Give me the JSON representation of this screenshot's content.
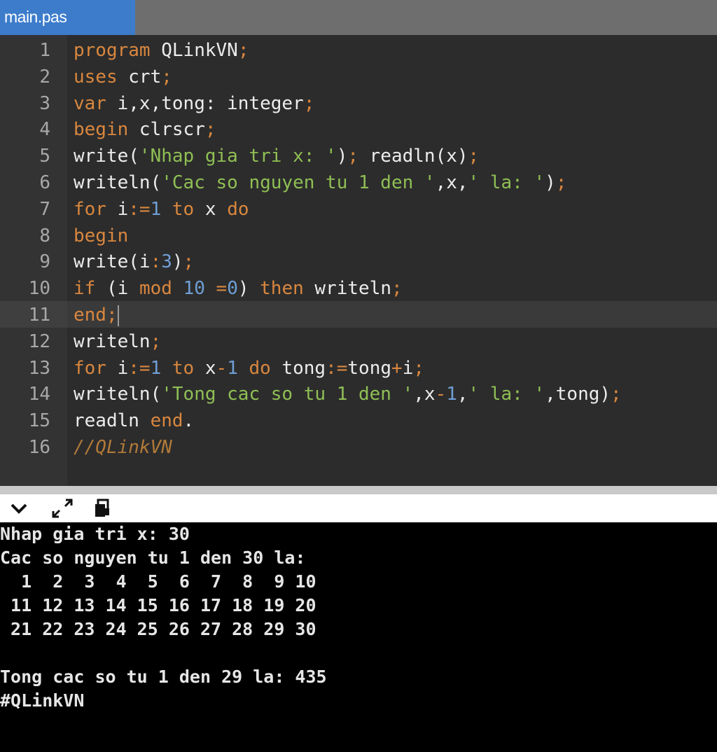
{
  "tab": {
    "title": "main.pas"
  },
  "editor": {
    "line_numbers": [
      "1",
      "2",
      "3",
      "4",
      "5",
      "6",
      "7",
      "8",
      "9",
      "10",
      "11",
      "12",
      "13",
      "14",
      "15",
      "16"
    ],
    "lines": [
      [
        {
          "t": "program",
          "c": "kw"
        },
        {
          "t": " QLinkVN",
          "c": ""
        },
        {
          "t": ";",
          "c": "op"
        }
      ],
      [
        {
          "t": "uses",
          "c": "kw"
        },
        {
          "t": " crt",
          "c": ""
        },
        {
          "t": ";",
          "c": "op"
        }
      ],
      [
        {
          "t": "var",
          "c": "kw"
        },
        {
          "t": " i,x,tong: integer",
          "c": ""
        },
        {
          "t": ";",
          "c": "op"
        }
      ],
      [
        {
          "t": "begin",
          "c": "kw"
        },
        {
          "t": " clrscr",
          "c": ""
        },
        {
          "t": ";",
          "c": "op"
        }
      ],
      [
        {
          "t": "write(",
          "c": ""
        },
        {
          "t": "'Nhap gia tri x: '",
          "c": "str"
        },
        {
          "t": ")",
          "c": ""
        },
        {
          "t": ";",
          "c": "op"
        },
        {
          "t": " readln(x)",
          "c": ""
        },
        {
          "t": ";",
          "c": "op"
        }
      ],
      [
        {
          "t": "writeln(",
          "c": ""
        },
        {
          "t": "'Cac so nguyen tu 1 den '",
          "c": "str"
        },
        {
          "t": ",x,",
          "c": ""
        },
        {
          "t": "' la: '",
          "c": "str"
        },
        {
          "t": ")",
          "c": ""
        },
        {
          "t": ";",
          "c": "op"
        }
      ],
      [
        {
          "t": "for",
          "c": "kw"
        },
        {
          "t": " i",
          "c": ""
        },
        {
          "t": ":=",
          "c": "op"
        },
        {
          "t": "1",
          "c": "num"
        },
        {
          "t": " ",
          "c": ""
        },
        {
          "t": "to",
          "c": "kw"
        },
        {
          "t": " x ",
          "c": ""
        },
        {
          "t": "do",
          "c": "kw"
        }
      ],
      [
        {
          "t": "begin",
          "c": "kw"
        }
      ],
      [
        {
          "t": "write(i",
          "c": ""
        },
        {
          "t": ":",
          "c": "op"
        },
        {
          "t": "3",
          "c": "num"
        },
        {
          "t": ")",
          "c": ""
        },
        {
          "t": ";",
          "c": "op"
        }
      ],
      [
        {
          "t": "if",
          "c": "kw"
        },
        {
          "t": " (i ",
          "c": ""
        },
        {
          "t": "mod",
          "c": "kw"
        },
        {
          "t": " ",
          "c": ""
        },
        {
          "t": "10",
          "c": "num"
        },
        {
          "t": " ",
          "c": ""
        },
        {
          "t": "=",
          "c": "op"
        },
        {
          "t": "0",
          "c": "num"
        },
        {
          "t": ") ",
          "c": ""
        },
        {
          "t": "then",
          "c": "kw"
        },
        {
          "t": " writeln",
          "c": ""
        },
        {
          "t": ";",
          "c": "op"
        }
      ],
      [
        {
          "t": "end",
          "c": "kw"
        },
        {
          "t": ";",
          "c": "op"
        }
      ],
      [
        {
          "t": "writeln",
          "c": ""
        },
        {
          "t": ";",
          "c": "op"
        }
      ],
      [
        {
          "t": "for",
          "c": "kw"
        },
        {
          "t": " i",
          "c": ""
        },
        {
          "t": ":=",
          "c": "op"
        },
        {
          "t": "1",
          "c": "num"
        },
        {
          "t": " ",
          "c": ""
        },
        {
          "t": "to",
          "c": "kw"
        },
        {
          "t": " x",
          "c": ""
        },
        {
          "t": "-",
          "c": "op"
        },
        {
          "t": "1",
          "c": "num"
        },
        {
          "t": " ",
          "c": ""
        },
        {
          "t": "do",
          "c": "kw"
        },
        {
          "t": " tong",
          "c": ""
        },
        {
          "t": ":=",
          "c": "op"
        },
        {
          "t": "tong",
          "c": ""
        },
        {
          "t": "+",
          "c": "op"
        },
        {
          "t": "i",
          "c": ""
        },
        {
          "t": ";",
          "c": "op"
        }
      ],
      [
        {
          "t": "writeln(",
          "c": ""
        },
        {
          "t": "'Tong cac so tu 1 den '",
          "c": "str"
        },
        {
          "t": ",x",
          "c": ""
        },
        {
          "t": "-",
          "c": "op"
        },
        {
          "t": "1",
          "c": "num"
        },
        {
          "t": ",",
          "c": ""
        },
        {
          "t": "' la: '",
          "c": "str"
        },
        {
          "t": ",tong)",
          "c": ""
        },
        {
          "t": ";",
          "c": "op"
        }
      ],
      [
        {
          "t": "readln ",
          "c": ""
        },
        {
          "t": "end",
          "c": "kw"
        },
        {
          "t": ".",
          "c": ""
        }
      ],
      [
        {
          "t": "//QLinkVN",
          "c": "cmt"
        }
      ]
    ]
  },
  "toolbar": {
    "icons": [
      "chevron-down-icon",
      "expand-icon",
      "copy-icon"
    ]
  },
  "terminal": {
    "lines": [
      "Nhap gia tri x: 30",
      "Cac so nguyen tu 1 den 30 la:",
      "  1  2  3  4  5  6  7  8  9 10",
      " 11 12 13 14 15 16 17 18 19 20",
      " 21 22 23 24 25 26 27 28 29 30",
      "",
      "Tong cac so tu 1 den 29 la: 435",
      "#QLinkVN"
    ]
  },
  "colors": {
    "keyword": "#d9873f",
    "string": "#8fbf54",
    "number": "#6f9fd6",
    "tab_active": "#3d7ccb"
  }
}
